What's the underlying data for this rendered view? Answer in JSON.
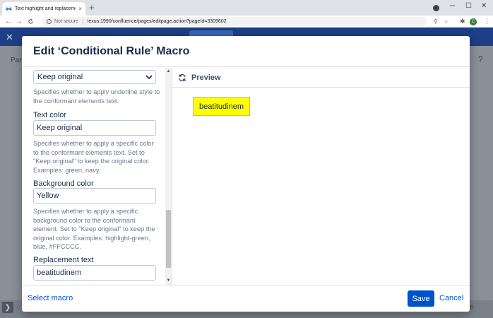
{
  "browser": {
    "tab_title": "Text highlight and replacement",
    "tab_close": "×",
    "new_tab": "+",
    "not_secure": "Not secure",
    "url": "lexus:1990/confluence/pages/editpage.action?pageId=3309602",
    "nav_back": "←",
    "nav_forward": "→",
    "reload": "C",
    "minimize": "─",
    "maximize": "☐",
    "close": "✕",
    "avatar_letter": "C",
    "menu": "⋮"
  },
  "background_page": {
    "title_fragment": "Par",
    "help": "?",
    "close_fragment": "ose"
  },
  "dialog": {
    "title": "Edit ‘Conditional Rule’ Macro",
    "left": {
      "underline_select_value": "Keep original",
      "underline_desc": "Specifies whether to apply underline style to the conformant elements text.",
      "text_color_label": "Text color",
      "text_color_value": "Keep original",
      "text_color_desc": "Specifies whether to apply a specific color to the conformant elements text. Set to \"Keep original\" to keep the original color. Examples: green, navy.",
      "bg_color_label": "Background color",
      "bg_color_value": "Yellow",
      "bg_color_desc": "Specifies whether to apply a specific background color to the conformant element. Set to \"Keep original\" to keep the original color. Examples: highlight-green, blue, #FFCCCC.",
      "replacement_label": "Replacement text",
      "replacement_value": "beatitudinem"
    },
    "preview": {
      "label": "Preview",
      "content": "beatitudinem",
      "highlight_color": "#ffff00"
    },
    "footer": {
      "select_macro": "Select macro",
      "save": "Save",
      "cancel": "Cancel"
    }
  },
  "colors": {
    "primary": "#0052cc",
    "header_blue": "#1d3f85"
  }
}
